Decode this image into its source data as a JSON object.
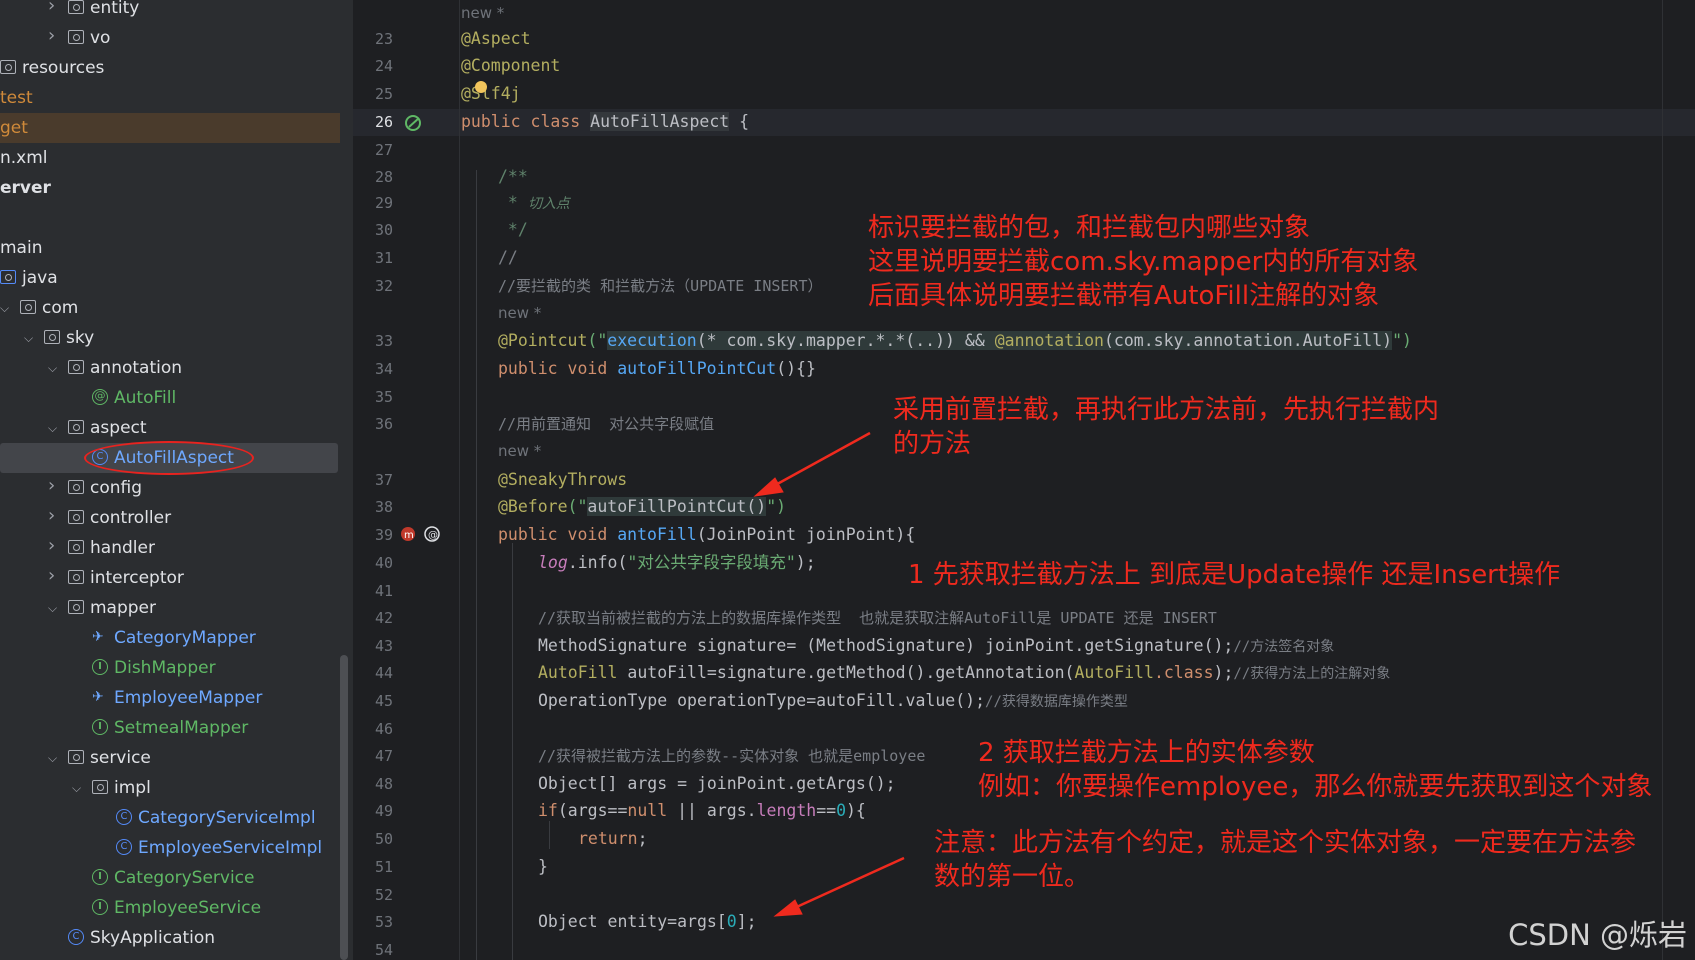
{
  "sidebar": {
    "items": [
      {
        "label": "entity",
        "kind": "folder",
        "indent": 68,
        "chev": "right"
      },
      {
        "label": "vo",
        "kind": "folder",
        "indent": 68,
        "chev": "right"
      },
      {
        "label": "resources",
        "kind": "folder",
        "indent": 0,
        "chev": ""
      },
      {
        "label": "test",
        "kind": "plain-orange",
        "indent": 0,
        "chev": ""
      },
      {
        "label": "get",
        "kind": "plain-orange",
        "indent": 0,
        "chev": "",
        "state": "sel-dim"
      },
      {
        "label": "n.xml",
        "kind": "plain",
        "indent": 0,
        "chev": ""
      },
      {
        "label": "erver",
        "kind": "plain-bold",
        "indent": 0,
        "chev": ""
      },
      {
        "label": "",
        "kind": "empty",
        "indent": 0,
        "chev": ""
      },
      {
        "label": "main",
        "kind": "plain",
        "indent": 0,
        "chev": ""
      },
      {
        "label": "java",
        "kind": "folder-blue",
        "indent": 0,
        "chev": ""
      },
      {
        "label": "com",
        "kind": "folder",
        "indent": 20,
        "chev": "down"
      },
      {
        "label": "sky",
        "kind": "folder",
        "indent": 44,
        "chev": "down"
      },
      {
        "label": "annotation",
        "kind": "folder",
        "indent": 68,
        "chev": "down"
      },
      {
        "label": "AutoFill",
        "kind": "annotation",
        "indent": 92,
        "chev": ""
      },
      {
        "label": "aspect",
        "kind": "folder",
        "indent": 68,
        "chev": "down"
      },
      {
        "label": "AutoFillAspect",
        "kind": "class",
        "indent": 92,
        "chev": "",
        "state": "sel"
      },
      {
        "label": "config",
        "kind": "folder",
        "indent": 68,
        "chev": "right"
      },
      {
        "label": "controller",
        "kind": "folder",
        "indent": 68,
        "chev": "right"
      },
      {
        "label": "handler",
        "kind": "folder",
        "indent": 68,
        "chev": "right"
      },
      {
        "label": "interceptor",
        "kind": "folder",
        "indent": 68,
        "chev": "right"
      },
      {
        "label": "mapper",
        "kind": "folder",
        "indent": 68,
        "chev": "down"
      },
      {
        "label": "CategoryMapper",
        "kind": "mapper",
        "indent": 92,
        "chev": ""
      },
      {
        "label": "DishMapper",
        "kind": "interface",
        "indent": 92,
        "chev": ""
      },
      {
        "label": "EmployeeMapper",
        "kind": "mapper",
        "indent": 92,
        "chev": ""
      },
      {
        "label": "SetmealMapper",
        "kind": "interface",
        "indent": 92,
        "chev": ""
      },
      {
        "label": "service",
        "kind": "folder",
        "indent": 68,
        "chev": "down"
      },
      {
        "label": "impl",
        "kind": "folder",
        "indent": 92,
        "chev": "down"
      },
      {
        "label": "CategoryServiceImpl",
        "kind": "class",
        "indent": 116,
        "chev": ""
      },
      {
        "label": "EmployeeServiceImpl",
        "kind": "class",
        "indent": 116,
        "chev": ""
      },
      {
        "label": "CategoryService",
        "kind": "interface",
        "indent": 92,
        "chev": ""
      },
      {
        "label": "EmployeeService",
        "kind": "interface",
        "indent": 92,
        "chev": ""
      },
      {
        "label": "SkyApplication",
        "kind": "app",
        "indent": 68,
        "chev": ""
      }
    ]
  },
  "editor": {
    "hint_new": "new *",
    "lines": {
      "l23": {
        "num": "23",
        "t1": "@Aspect"
      },
      "l24": {
        "num": "24",
        "t1": "@Component"
      },
      "l25": {
        "num": "25",
        "t1": "@Slf4j"
      },
      "l26": {
        "num": "26",
        "k1": "public",
        "k2": "class",
        "cls": "AutoFillAspect",
        "brace": "{"
      },
      "l27": {
        "num": "27"
      },
      "l28": {
        "num": "28",
        "t1": "/**"
      },
      "l29": {
        "num": "29",
        "t1": " * ",
        "t2": "切入点"
      },
      "l30": {
        "num": "30",
        "t1": " */"
      },
      "l31": {
        "num": "31",
        "t1": "//"
      },
      "l32": {
        "num": "32",
        "t1": "//要拦截的类 和拦截方法（UPDATE INSERT）"
      },
      "l33": {
        "num": "33",
        "a": "@Pointcut",
        "p1": "(\"",
        "ex": "execution",
        "p2": "(* com.sky.mapper.*.*(..)) && ",
        "an": "@annotation",
        "p3": "(com.sky.annotation.AutoFill)",
        "p4": "\")"
      },
      "l34": {
        "num": "34",
        "k1": "public",
        "k2": "void",
        "fn": "autoFillPointCut",
        "rest": "(){}"
      },
      "l35": {
        "num": "35"
      },
      "l36": {
        "num": "36",
        "t1": "//用前置通知  对公共字段赋值"
      },
      "l37": {
        "num": "37",
        "t1": "@SneakyThrows"
      },
      "l38": {
        "num": "38",
        "a": "@Before",
        "p1": "(\"",
        "s": "autoFillPointCut()",
        "p2": "\")"
      },
      "l39": {
        "num": "39",
        "k1": "public",
        "k2": "void",
        "fn": "antoFill",
        "rest": "(JoinPoint joinPoint){"
      },
      "l40": {
        "num": "40",
        "lg": "log",
        "m": ".info(",
        "s": "\"对公共字段字段填充\"",
        "e": ");"
      },
      "l41": {
        "num": "41"
      },
      "l42": {
        "num": "42",
        "t1": "//获取当前被拦截的方法上的数据库操作类型  也就是获取注解AutoFill是 UPDATE 还是 INSERT"
      },
      "l43": {
        "num": "43",
        "t1": "MethodSignature signature= (MethodSignature) joinPoint.getSignature();",
        "c": "//方法签名对象"
      },
      "l44": {
        "num": "44",
        "ty": "AutoFill",
        "t1": " autoFill=signature.getMethod().getAnnotation(",
        "ty2": "AutoFill",
        "k": ".class",
        "t2": ");",
        "c": "//获得方法上的注解对象"
      },
      "l45": {
        "num": "45",
        "t1": "OperationType operationType=autoFill.value();",
        "c": "//获得数据库操作类型"
      },
      "l46": {
        "num": "46"
      },
      "l47": {
        "num": "47",
        "t1": "//获得被拦截方法上的参数--实体对象 也就是employee"
      },
      "l48": {
        "num": "48",
        "t1": "Object[] args = joinPoint.getArgs();"
      },
      "l49": {
        "num": "49",
        "k": "if",
        "t1": "(args==",
        "k2": "null",
        "t2": " || args.",
        "f": "length",
        "t3": "==",
        "n": "0",
        "t4": "){"
      },
      "l50": {
        "num": "50",
        "k": "return",
        "t1": ";"
      },
      "l51": {
        "num": "51",
        "t1": "}"
      },
      "l52": {
        "num": "52"
      },
      "l53": {
        "num": "53",
        "t1": "Object entity=args[",
        "n": "0",
        "t2": "];"
      },
      "l54": {
        "num": "54"
      }
    }
  },
  "notes": {
    "n1": [
      "标识要拦截的包，和拦截包内哪些对象",
      "这里说明要拦截com.sky.mapper内的所有对象",
      "后面具体说明要拦截带有AutoFill注解的对象"
    ],
    "n2": [
      "采用前置拦截，再执行此方法前，先执行拦截内",
      "的方法"
    ],
    "n3": [
      "1 先获取拦截方法上 到底是Update操作 还是Insert操作"
    ],
    "n4": [
      "2 获取拦截方法上的实体参数",
      "例如：你要操作employee，那么你就要先获取到这个对象"
    ],
    "n5": [
      "注意：此方法有个约定，就是这个实体对象，一定要在方法参",
      "数的第一位。"
    ]
  },
  "watermark": "CSDN @烁岩",
  "colors": {
    "note": "#ef2a1e",
    "keyword": "#cf8e6d",
    "annotation": "#b3ae60",
    "function": "#56a8f5",
    "string": "#6aab73"
  }
}
